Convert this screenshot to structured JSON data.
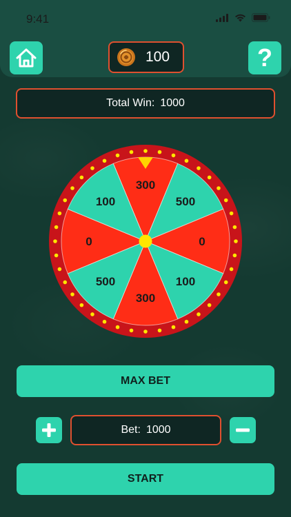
{
  "status_bar": {
    "time": "9:41"
  },
  "header": {
    "coins": "100"
  },
  "total_win": {
    "label": "Total Win:",
    "value": "1000"
  },
  "wheel": {
    "segments": [
      {
        "label": "300",
        "color": "#ff2d16"
      },
      {
        "label": "500",
        "color": "#2ed3ad"
      },
      {
        "label": "0",
        "color": "#ff2d16"
      },
      {
        "label": "100",
        "color": "#2ed3ad"
      },
      {
        "label": "300",
        "color": "#ff2d16"
      },
      {
        "label": "500",
        "color": "#2ed3ad"
      },
      {
        "label": "0",
        "color": "#ff2d16"
      },
      {
        "label": "100",
        "color": "#2ed3ad"
      }
    ],
    "rim_color": "#c8141a",
    "bulb_color": "#ffe600",
    "pointer_color": "#ffd400"
  },
  "controls": {
    "max_bet_label": "MAX BET",
    "bet_label": "Bet:",
    "bet_value": "1000",
    "start_label": "START"
  },
  "colors": {
    "accent": "#2ed3ad",
    "border": "#e0502f",
    "background": "#143a31"
  },
  "icons": [
    "home-icon",
    "question-icon",
    "coin-icon",
    "plus-icon",
    "minus-icon",
    "signal-icon",
    "wifi-icon",
    "battery-icon"
  ]
}
